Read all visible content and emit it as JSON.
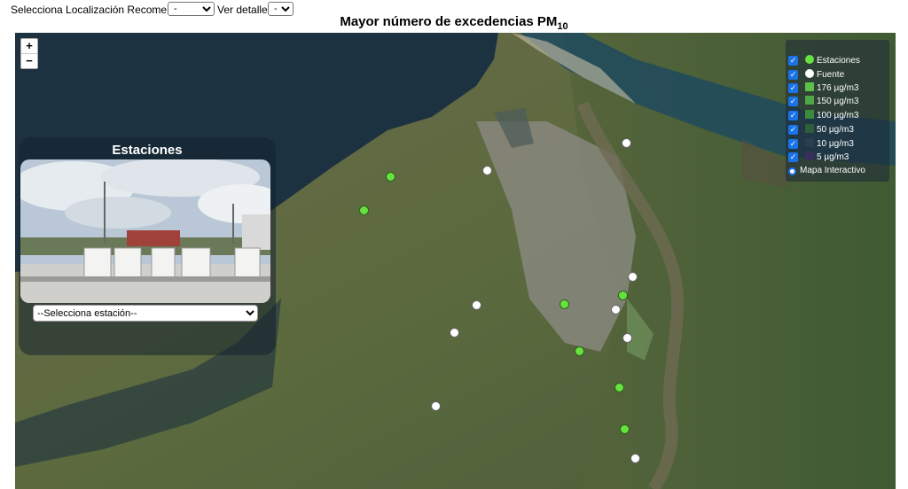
{
  "toolbar": {
    "location_label": "Selecciona Localización Recomendada:",
    "location_value": "-",
    "details_label": "Ver detalles:",
    "details_value": "-"
  },
  "title": {
    "main": "Mayor número de excedencias PM",
    "sub": "10"
  },
  "zoom": {
    "in_label": "+",
    "out_label": "−"
  },
  "station_panel": {
    "title": "Estaciones",
    "select_placeholder": "--Selecciona estación--"
  },
  "legend": {
    "items": [
      {
        "label": "Estaciones",
        "kind": "dot",
        "color": "#66e23f",
        "checked": true
      },
      {
        "label": "Fuente",
        "kind": "dot",
        "color": "#ffffff",
        "checked": true
      },
      {
        "label": "176 µg/m3",
        "kind": "square",
        "color": "#5cbf4a",
        "checked": true
      },
      {
        "label": "150 µg/m3",
        "kind": "square",
        "color": "#4fa845",
        "checked": true
      },
      {
        "label": "100 µg/m3",
        "kind": "square",
        "color": "#3d8a3f",
        "checked": true
      },
      {
        "label": "50 µg/m3",
        "kind": "square",
        "color": "#2f5e3a",
        "checked": true
      },
      {
        "label": "10 µg/m3",
        "kind": "square",
        "color": "#2b3d52",
        "checked": true
      },
      {
        "label": "5 µg/m3",
        "kind": "square",
        "color": "#3a2f5c",
        "checked": true
      }
    ],
    "radio_label": "Mapa Interactivo"
  },
  "markers": [
    {
      "type": "green",
      "name": "estacion"
    },
    {
      "type": "green",
      "name": "estacion"
    },
    {
      "type": "white",
      "name": "fuente"
    },
    {
      "type": "white",
      "name": "fuente"
    },
    {
      "type": "white",
      "name": "fuente"
    },
    {
      "type": "green",
      "name": "estacion"
    },
    {
      "type": "green",
      "name": "estacion"
    },
    {
      "type": "white",
      "name": "fuente"
    },
    {
      "type": "white",
      "name": "fuente"
    },
    {
      "type": "white",
      "name": "fuente"
    },
    {
      "type": "green",
      "name": "estacion"
    },
    {
      "type": "white",
      "name": "fuente"
    },
    {
      "type": "green",
      "name": "estacion"
    },
    {
      "type": "white",
      "name": "fuente"
    },
    {
      "type": "green",
      "name": "estacion"
    },
    {
      "type": "white",
      "name": "fuente"
    }
  ]
}
